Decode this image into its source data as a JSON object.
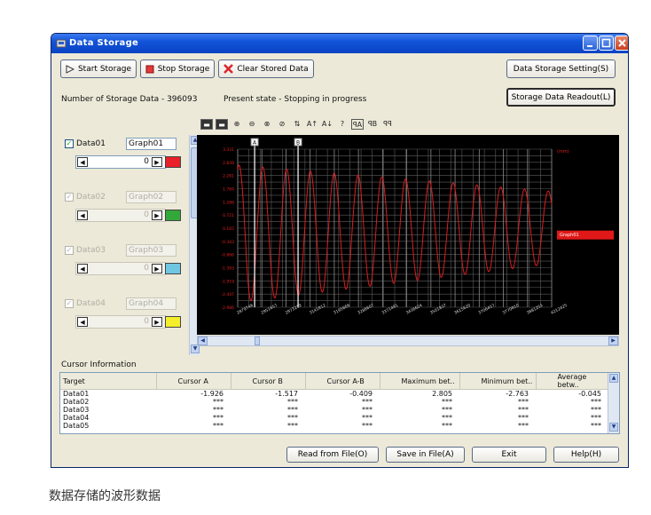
{
  "window": {
    "title": "Data Storage"
  },
  "toolbar": {
    "start_label": "Start Storage",
    "stop_label": "Stop Storage",
    "clear_label": "Clear Stored Data",
    "setting_label": "Data Storage Setting(S)",
    "readout_label": "Storage Data Readout(L)"
  },
  "status": {
    "count_text": "Number of Storage Data - 396093",
    "state_text": "Present state - Stopping in progress"
  },
  "channels": [
    {
      "name": "Data01",
      "graph": "Graph01",
      "value": "0",
      "color": "#e8202a",
      "checked": true
    },
    {
      "name": "Data02",
      "graph": "Graph02",
      "value": "0",
      "color": "#33a83a",
      "checked": true
    },
    {
      "name": "Data03",
      "graph": "Graph03",
      "value": "0",
      "color": "#6fc6e0",
      "checked": true
    },
    {
      "name": "Data04",
      "graph": "Graph04",
      "value": "0",
      "color": "#f5ee2a",
      "checked": true
    }
  ],
  "chart_data": {
    "type": "line",
    "unit_label": "(mm)",
    "y_ticks": [
      "3.331",
      "2.839",
      "2.281",
      "1.769",
      "1.288",
      "0.721",
      "0.165",
      "-0.343",
      "-0.866",
      "-1.393",
      "-1.919",
      "-2.447",
      "-2.986"
    ],
    "x_ticks": [
      "2879746",
      "2951657",
      "2973219",
      "3141812",
      "3195666",
      "3286607",
      "3371491",
      "3436624",
      "3501837",
      "3615620",
      "3706457",
      "3770810",
      "3881251",
      "4212425"
    ],
    "ylim": [
      -2.986,
      3.331
    ],
    "grid": true,
    "cursors": [
      {
        "label": "A",
        "position": 2951657,
        "color": "#ffffff"
      },
      {
        "label": "B",
        "position": 3136000,
        "color": "#ffffff"
      }
    ],
    "series": [
      {
        "name": "Graph01",
        "color": "#d81e20"
      }
    ]
  },
  "cursor_info": {
    "title": "Cursor Information",
    "columns": [
      "Target",
      "Cursor A",
      "Cursor B",
      "Cursor A-B",
      "Maximum bet..",
      "Minimum bet..",
      "Average betw.."
    ],
    "rows": [
      [
        "Data01",
        "-1.926",
        "-1.517",
        "-0.409",
        "2.805",
        "-2.763",
        "-0.045"
      ],
      [
        "Data02",
        "***",
        "***",
        "***",
        "***",
        "***",
        "***"
      ],
      [
        "Data03",
        "***",
        "***",
        "***",
        "***",
        "***",
        "***"
      ],
      [
        "Data04",
        "***",
        "***",
        "***",
        "***",
        "***",
        "***"
      ],
      [
        "Data05",
        "***",
        "***",
        "***",
        "***",
        "***",
        "***"
      ]
    ]
  },
  "footer": {
    "read_label": "Read from File(O)",
    "save_label": "Save in File(A)",
    "exit_label": "Exit",
    "help_label": "Help(H)"
  },
  "caption": "数据存储的波形数据"
}
